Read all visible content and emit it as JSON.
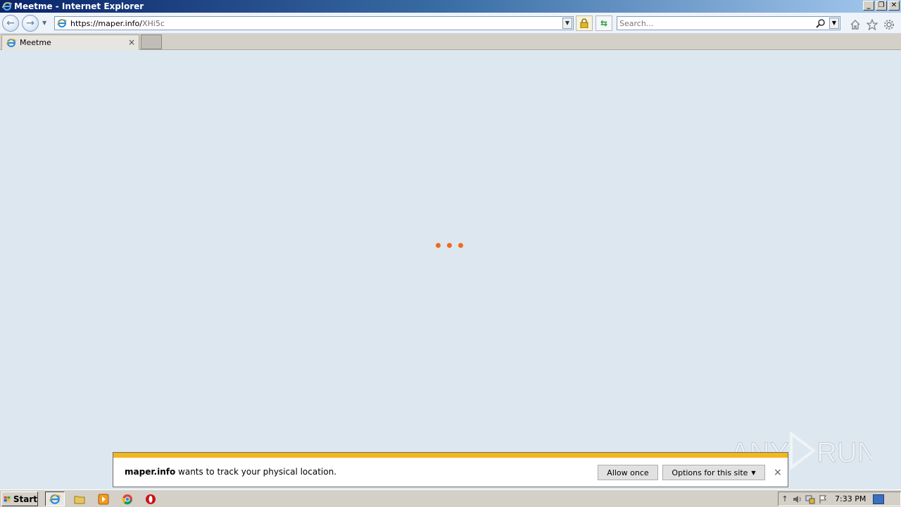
{
  "window": {
    "title": "Meetme - Internet Explorer",
    "min_label": "_",
    "restore_label": "❐",
    "close_label": "✕"
  },
  "navbar": {
    "url_host": "https://maper.info/",
    "url_path": "XHi5c",
    "search_placeholder": "Search..."
  },
  "tabs": [
    {
      "label": "Meetme",
      "close": "×"
    }
  ],
  "notification": {
    "site": "maper.info",
    "message": " wants to track your physical location.",
    "allow_once": "Allow once",
    "options": "Options for this site",
    "close": "×"
  },
  "taskbar": {
    "start_label": "Start",
    "clock": "7:33 PM"
  },
  "watermark": {
    "text_left": "ANY",
    "text_right": "RUN"
  },
  "colors": {
    "loader": "#f06a1f",
    "accent": "#f3b61f"
  }
}
